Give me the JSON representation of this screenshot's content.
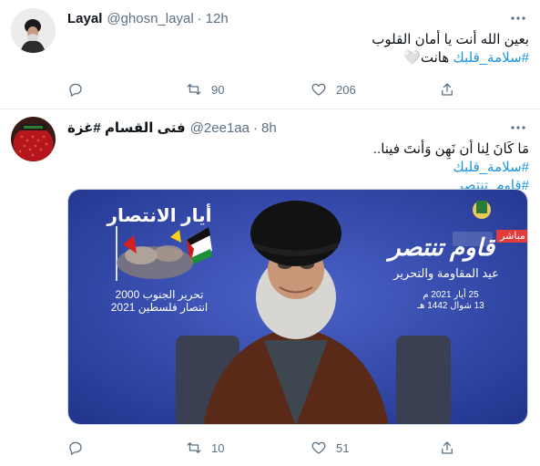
{
  "tweets": [
    {
      "name": "Layal",
      "handle": "@ghosn_layal",
      "separator": "·",
      "time": "12h",
      "text_line1": "بعين الله أنت يا أمان القلوب",
      "hashtag_line": "#سلامة_قلبك",
      "text_line2_suffix": "هانت",
      "emoji": "🤍",
      "reply_count": "",
      "retweet_count": "90",
      "like_count": "206"
    },
    {
      "name": "فتى القسام #غزة",
      "handle": "@2ee1aa",
      "separator": "·",
      "time": "8h",
      "text_line1": "مَا كَانَ لِنا أن نَهِن وَأنتَ فينا..",
      "hashtag_line": "#سلامة_قلبك",
      "hashtag_line3": "#قاوم_تنتصر",
      "media_overlay": {
        "left_title": "أيار الانتصار",
        "left_sub1": "تحرير الجنوب 2000",
        "left_sub2": "انتصار فلسطين 2021",
        "right_badge": "مباشر",
        "right_title": "قاوم تنتصر",
        "right_sub": "عيد المقاومة والتحرير",
        "date1": "25 أيار 2021 م",
        "date2": "13 شوال 1442 هـ"
      },
      "reply_count": "",
      "retweet_count": "10",
      "like_count": "51"
    }
  ],
  "colors": {
    "link": "#1b95e0",
    "muted": "#5b7083",
    "media_bg": "#2a3f9e"
  },
  "icons": [
    "reply-icon",
    "retweet-icon",
    "like-icon",
    "share-icon",
    "more-icon"
  ]
}
